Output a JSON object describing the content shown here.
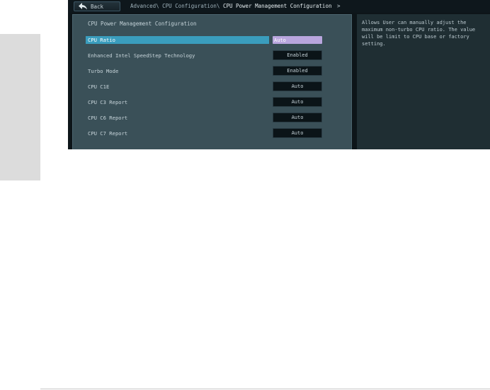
{
  "header": {
    "back_label": "Back",
    "breadcrumb": {
      "part1": "Advanced\\",
      "part2": "CPU Configuration\\",
      "current": "CPU Power Management Configuration",
      "chevron": ">"
    }
  },
  "panel": {
    "title": "CPU Power Management Configuration",
    "settings": [
      {
        "label": "CPU Ratio",
        "value": "Auto"
      },
      {
        "label": "Enhanced Intel SpeedStep Technology",
        "value": "Enabled"
      },
      {
        "label": "Turbo Mode",
        "value": "Enabled"
      },
      {
        "label": "CPU C1E",
        "value": "Auto"
      },
      {
        "label": "CPU C3 Report",
        "value": "Auto"
      },
      {
        "label": "CPU C6 Report",
        "value": "Auto"
      },
      {
        "label": "CPU C7 Report",
        "value": "Auto"
      }
    ]
  },
  "help": {
    "text": "Allows User can manually adjust the maximum non-turbo CPU ratio. The value will be limit to CPU base or factory setting."
  },
  "icons": {
    "back": "back-arrow-icon"
  },
  "colors": {
    "selection_bar": "#3a9dbd",
    "active_value": "#b9a6de",
    "panel_bg": "#3a5058",
    "help_bg": "#1f2e33"
  }
}
